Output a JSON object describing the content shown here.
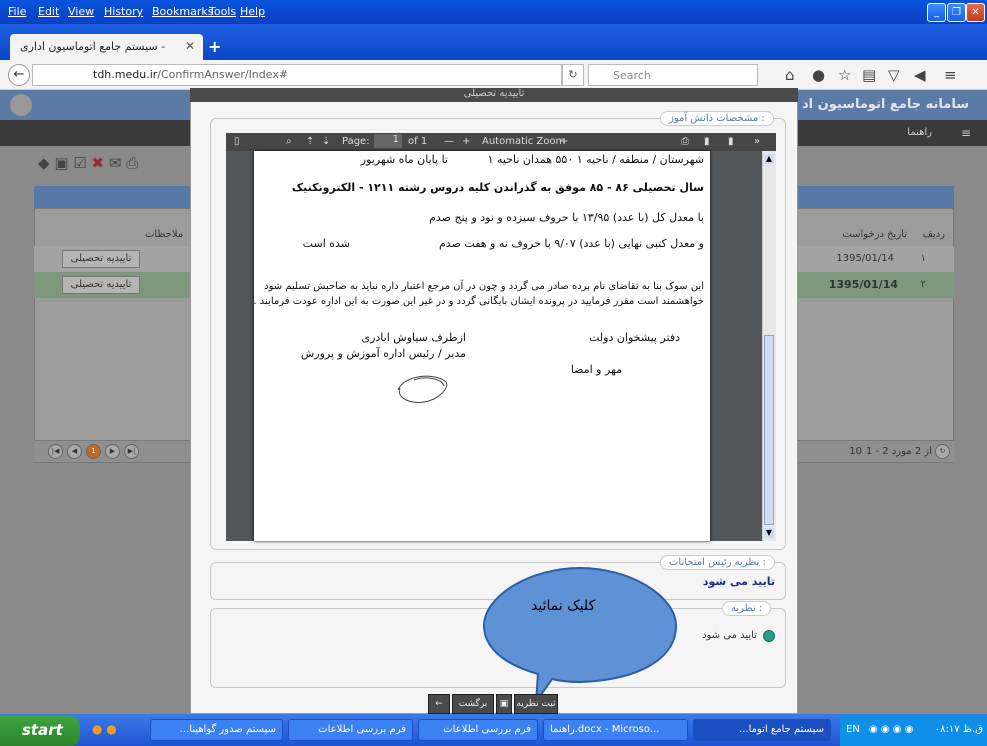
{
  "browser": {
    "menu": [
      "File",
      "Edit",
      "View",
      "History",
      "Bookmarks",
      "Tools",
      "Help"
    ],
    "tab_title": "سیستم جامع اتوماسیون اداری -",
    "url_domain": "tdh.medu.ir",
    "url_path": "/ConfirmAnswer/Index#",
    "search_placeholder": "Search"
  },
  "app": {
    "title": "سامانه جامع اتوماسیون اد",
    "guide": "راهنما",
    "columns": {
      "row": "ردیف",
      "date": "تاریخ درخواست",
      "extra": "ملاحظات"
    },
    "rows": [
      {
        "num": "۱",
        "date": "1395/01/14",
        "button": "تاییدیه تحصیلی"
      },
      {
        "num": "۲",
        "date": "1395/01/14",
        "button": "تاییدیه تحصیلی"
      }
    ],
    "pager_size": "10",
    "pager_info": "1 - 2 از 2 مورد",
    "pager_page": "1"
  },
  "modal": {
    "title": "تاییدیه تحصیلی",
    "student_legend": "مشخصات دانش آموز :",
    "pdf": {
      "page_label": "Page:",
      "page_num": "1",
      "page_of": "of 1",
      "zoom": "Automatic Zoom",
      "lines": [
        "شهرستان / منطقه / ناحیه ۱ ۵۵۰ همدان ناحیه ۱",
        "تا پایان ماه شهریور",
        "سال تحصیلی ۸۶ - ۸۵  موفق به گذراندن کلیه دروس رشته ۱۲۱۱ - الکترونکنیک",
        "با معدل کل (با عدد) ۱۳/۹۵  با حروف  سیزده و نود و پنج صدم",
        "و معدل کتبی نهایی (با عدد) ۹/۰۷  با حروف  نه و هفت صدم",
        "شده است",
        "این سوک بنا به تقاضای نام برده صادر می گردد و چون در آن مرجع اعتبار داره نباید به صاحبش تسلیم شود",
        "خواهشمند است مقرر فرمایید در پرونده ایشان بایگانی گردد و در غیر این صورت به این اداره عودت فرمایند .",
        "دفتر پیشخوان دولت",
        "ازطرف  سیاوش ابادری",
        "مدیر / رئیس اداره آموزش و پرورش",
        "مهر و امضا"
      ]
    },
    "head_opinion_legend": "نظریه رئیس امتحانات :",
    "head_opinion_value": "تایید می شود",
    "opinion_legend": "نظریه :",
    "opinion_option": "تایید می شود",
    "bubble_text": "کلیک نمائید",
    "btn_submit": "ثبت نظریه",
    "btn_back": "برگشت"
  },
  "taskbar": {
    "start": "start",
    "items": [
      "سیستم صدور گواهینا...",
      "فرم بررسی اطلاعات",
      "فرم بررسی اطلاعات",
      "راهنما.docx - Microso...",
      "سیستم جامع اتوما..."
    ],
    "tray_lang": "EN",
    "tray_time": "ق.ظ ۰۸:۱۷"
  }
}
